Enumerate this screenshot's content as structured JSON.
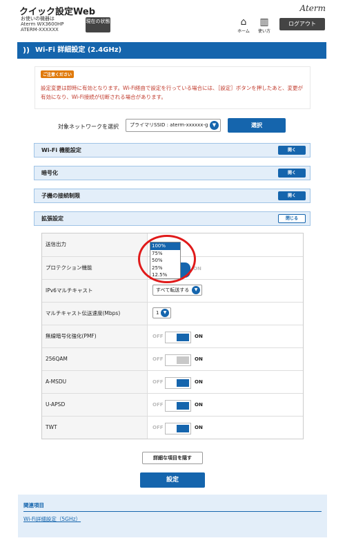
{
  "header": {
    "app_title": "クイック設定Web",
    "device_line1": "お使いの機器は",
    "device_line2": "Aterm WX3600HP",
    "device_line3": "ATERM-XXXXXX",
    "status_button": "現在の状態",
    "brand": "Aterm",
    "home_label": "ホーム",
    "help_label": "使い方",
    "logout_label": "ログアウト"
  },
  "page_title": "Wi-Fi 詳細設定 (2.4GHz)",
  "notice": {
    "badge": "ご注意ください",
    "text": "設定変更は即時に有効となります。Wi-Fi経由で設定を行っている場合には、［設定］ボタンを押したあと、変更が有効になり、Wi-Fi接続が切断される場合があります。"
  },
  "network": {
    "label": "対象ネットワークを選択",
    "selected": "プライマリSSID : aterm-xxxxxx-g",
    "select_button": "選択"
  },
  "sections": [
    {
      "title": "Wi-Fi 機能設定",
      "button": "開く"
    },
    {
      "title": "暗号化",
      "button": "開く"
    },
    {
      "title": "子機の接続制限",
      "button": "開く"
    },
    {
      "title": "拡張設定",
      "button": "閉じる"
    }
  ],
  "settings": {
    "tx_power": {
      "label": "送信出力"
    },
    "protection": {
      "label": "プロテクション機能"
    },
    "ipv6_multicast": {
      "label": "IPv6マルチキャスト",
      "value": "すべて転送する"
    },
    "multicast_rate": {
      "label": "マルチキャスト伝送速度(Mbps)",
      "value": "1"
    },
    "pmf": {
      "label": "無線暗号化強化(PMF)"
    },
    "qam256": {
      "label": "256QAM"
    },
    "amsdu": {
      "label": "A-MSDU"
    },
    "uapsd": {
      "label": "U-APSD"
    },
    "twt": {
      "label": "TWT"
    },
    "off_label": "OFF",
    "on_label": "ON"
  },
  "tx_power_options": [
    "100%",
    "75%",
    "50%",
    "25%",
    "12.5%"
  ],
  "tx_power_selected": "100%",
  "hide_button": "詳細な項目を隠す",
  "set_button": "設定",
  "related": {
    "title": "関連項目",
    "link": "Wi-Fi詳細設定（5GHz）"
  },
  "colors": {
    "accent": "#1565ad",
    "notice_text": "#c0392b",
    "highlight_ring": "#e01a1a"
  }
}
